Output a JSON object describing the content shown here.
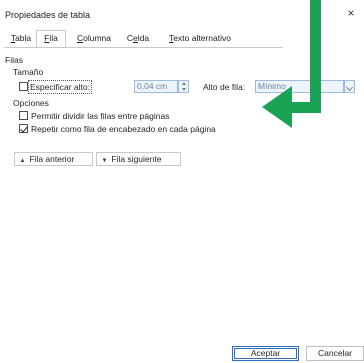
{
  "dialog": {
    "title": "Propiedades de tabla",
    "close_glyph": "×"
  },
  "tabs": [
    {
      "label": "Tabla",
      "mn": "T"
    },
    {
      "label": "Fila",
      "mn": "F"
    },
    {
      "label": "Columna",
      "mn": "C"
    },
    {
      "label": "Celda",
      "mn": "e"
    },
    {
      "label": "Texto alternativo",
      "mn": "T"
    }
  ],
  "tabs_render": {
    "t0_pre": "",
    "t0_mn": "T",
    "t0_post": "abla",
    "t1_pre": "",
    "t1_mn": "F",
    "t1_post": "ila",
    "t2_pre": "",
    "t2_mn": "C",
    "t2_post": "olumna",
    "t3_pre": "C",
    "t3_mn": "e",
    "t3_post": "lda",
    "t4_pre": "",
    "t4_mn": "T",
    "t4_post": "exto alternativo"
  },
  "section": {
    "filas": "Filas",
    "tamano": "Tamaño",
    "opciones": "Opciones"
  },
  "size": {
    "specify_height_label": "Especificar alto:",
    "specify_height_checked": false,
    "height_value": "0,04 cm",
    "row_height_label": "Alto de fila:",
    "row_height_value": "Mínimo"
  },
  "options": {
    "allow_break_label": "Permitir dividir las filas entre páginas",
    "allow_break_checked": false,
    "repeat_header_label": "Repetir como fila de encabezado en cada página",
    "repeat_header_checked": true
  },
  "nav": {
    "prev_label": "Fila anterior",
    "next_label": "Fila siguiente",
    "prev_icon": "triangle-up-icon",
    "next_icon": "triangle-down-icon"
  },
  "footer": {
    "ok_label": "Aceptar",
    "cancel_label": "Cancelar"
  },
  "colors": {
    "arrow_green": "#1aa355",
    "accent_blue": "#2b6fc2"
  }
}
